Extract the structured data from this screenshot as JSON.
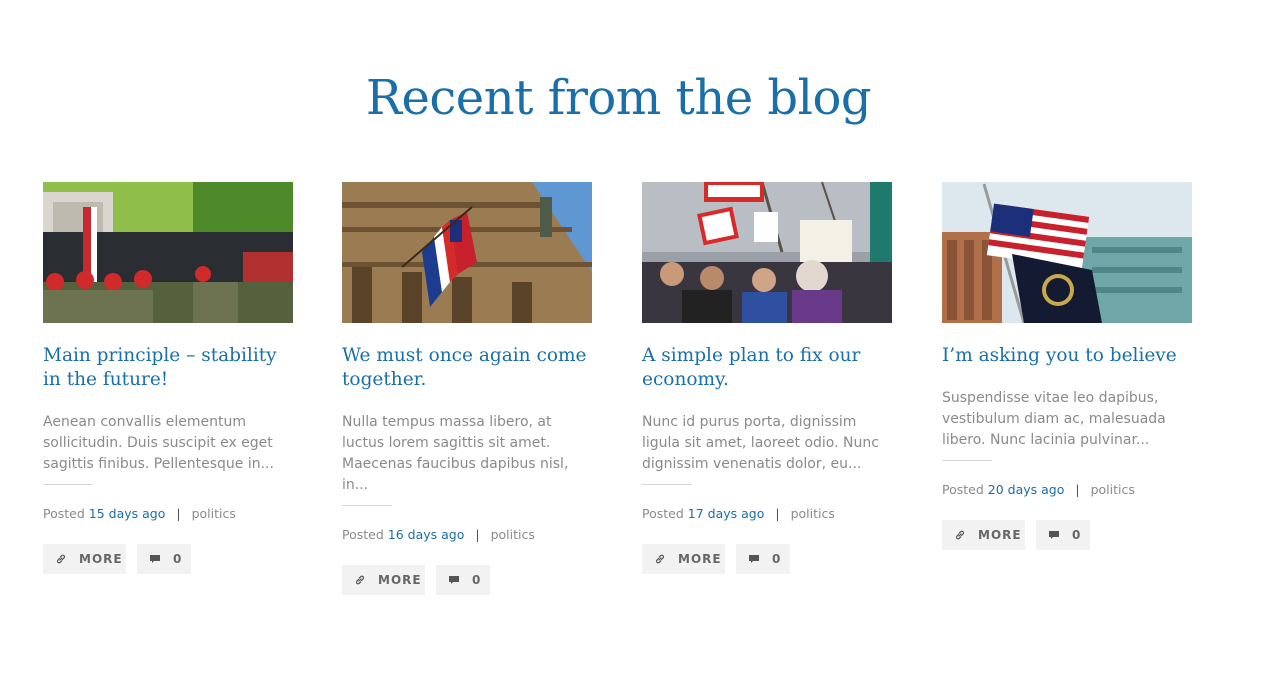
{
  "section": {
    "title": "Recent from the blog"
  },
  "posts": [
    {
      "title": "Main principle – stability in the future!",
      "excerpt": "Aenean convallis elementum sollicitudin. Duis suscipit ex eget sagittis finibus. Pellentesque in...",
      "posted_label": "Posted",
      "date": "15 days ago",
      "separator": "|",
      "category": "politics",
      "more_label": "MORE",
      "comments_count": "0",
      "image_icon": "parade-photo"
    },
    {
      "title": "We must once again come together.",
      "excerpt": "Nulla tempus massa libero, at luctus lorem sagittis sit amet. Maecenas faucibus dapibus nisl, in...",
      "posted_label": "Posted",
      "date": "16 days ago",
      "separator": "|",
      "category": "politics",
      "more_label": "MORE",
      "comments_count": "0",
      "image_icon": "flags-building-photo"
    },
    {
      "title": "A simple plan to fix our economy.",
      "excerpt": "Nunc id purus porta, dignissim ligula sit amet, laoreet odio. Nunc dignissim venenatis dolor, eu...",
      "posted_label": "Posted",
      "date": "17 days ago",
      "separator": "|",
      "category": "politics",
      "more_label": "MORE",
      "comments_count": "0",
      "image_icon": "protest-photo"
    },
    {
      "title": "I’m asking you to believe",
      "excerpt": "Suspendisse vitae leo dapibus, vestibulum diam ac, malesuada libero. Nunc lacinia pulvinar...",
      "posted_label": "Posted",
      "date": "20 days ago",
      "separator": "|",
      "category": "politics",
      "more_label": "MORE",
      "comments_count": "0",
      "image_icon": "us-flag-photo"
    }
  ],
  "icons": {
    "more": "link-icon",
    "comments": "comment-icon"
  },
  "colors": {
    "accent": "#1a6fa8",
    "text_muted": "#8a8a8a",
    "button_bg": "#f2f2f2"
  }
}
